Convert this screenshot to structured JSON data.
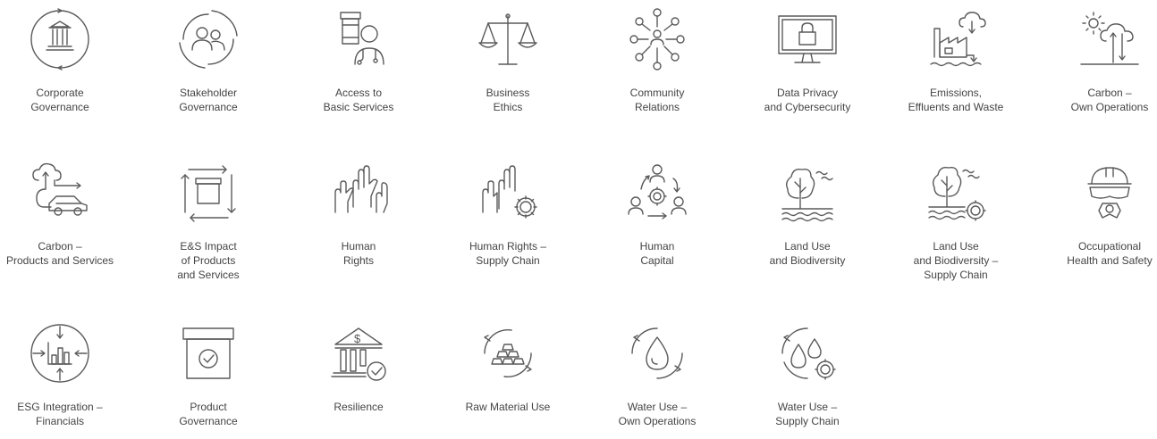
{
  "items": [
    {
      "label": "Corporate\nGovernance",
      "icon": "governance-bank-cycle-icon"
    },
    {
      "label": "Stakeholder\nGovernance",
      "icon": "stakeholder-cycle-icon"
    },
    {
      "label": "Access to\nBasic Services",
      "icon": "medicine-doctor-icon"
    },
    {
      "label": "Business\nEthics",
      "icon": "scales-icon"
    },
    {
      "label": "Community\nRelations",
      "icon": "community-network-icon"
    },
    {
      "label": "Data Privacy\nand Cybersecurity",
      "icon": "monitor-lock-icon"
    },
    {
      "label": "Emissions,\nEffluents and Waste",
      "icon": "factory-emissions-icon"
    },
    {
      "label": "Carbon –\nOwn Operations",
      "icon": "carbon-operations-icon"
    },
    {
      "label": "Carbon –\nProducts and Services",
      "icon": "car-cloud-icon"
    },
    {
      "label": "E&S Impact\nof Products\nand Services",
      "icon": "box-cycle-icon"
    },
    {
      "label": "Human\nRights",
      "icon": "raised-hands-icon"
    },
    {
      "label": "Human Rights –\nSupply Chain",
      "icon": "hands-gear-icon"
    },
    {
      "label": "Human\nCapital",
      "icon": "people-gear-cycle-icon"
    },
    {
      "label": "Land Use\nand Biodiversity",
      "icon": "tree-water-icon"
    },
    {
      "label": "Land Use\nand Biodiversity –\nSupply Chain",
      "icon": "tree-water-gear-icon"
    },
    {
      "label": "Occupational\nHealth and Safety",
      "icon": "hardhat-goggles-icon"
    },
    {
      "label": "ESG Integration –\nFinancials",
      "icon": "chart-target-icon"
    },
    {
      "label": "Product\nGovernance",
      "icon": "box-check-icon"
    },
    {
      "label": "Resilience",
      "icon": "bank-dollar-check-icon"
    },
    {
      "label": "Raw Material Use",
      "icon": "gold-bars-cycle-icon"
    },
    {
      "label": "Water Use –\nOwn Operations",
      "icon": "water-drop-cycle-icon"
    },
    {
      "label": "Water Use –\nSupply Chain",
      "icon": "water-drops-gear-icon"
    }
  ]
}
